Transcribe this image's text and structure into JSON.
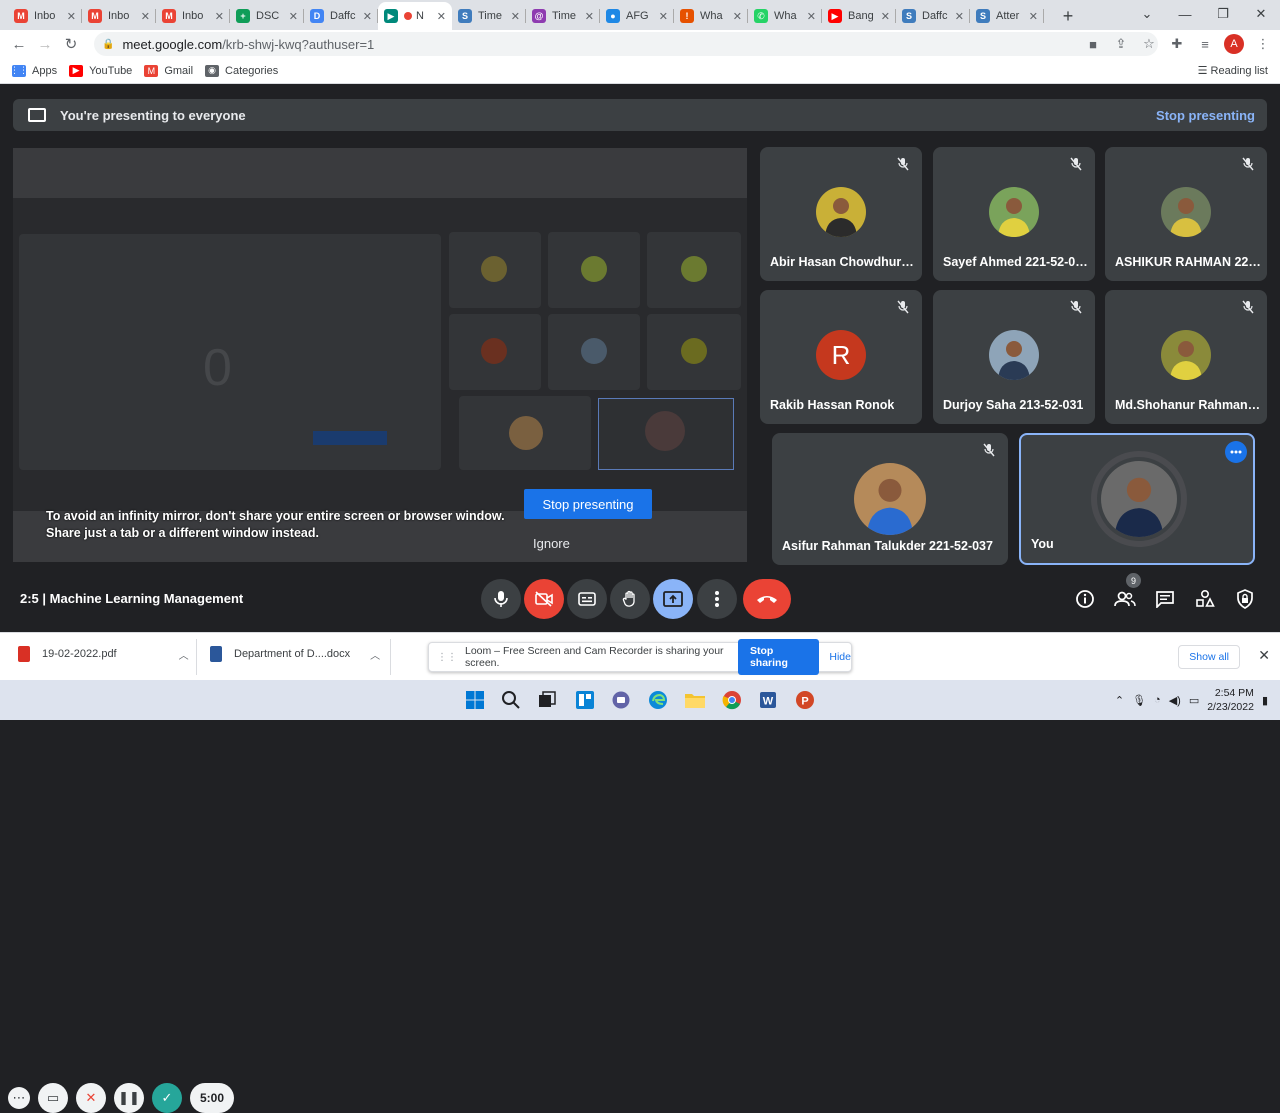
{
  "browser": {
    "tabs": [
      {
        "label": "Inbo",
        "color": "#ea4335",
        "glyph": "M"
      },
      {
        "label": "Inbo",
        "color": "#ea4335",
        "glyph": "M"
      },
      {
        "label": "Inbo",
        "color": "#ea4335",
        "glyph": "M"
      },
      {
        "label": "DSC",
        "color": "#0f9d58",
        "glyph": "+"
      },
      {
        "label": "Daffc",
        "color": "#4285f4",
        "glyph": "D"
      },
      {
        "label": "N",
        "color": "#00897b",
        "glyph": "▶",
        "active": true
      },
      {
        "label": "Time",
        "color": "#3f7cbd",
        "glyph": "S"
      },
      {
        "label": "Time",
        "color": "#8e3bb0",
        "glyph": "@"
      },
      {
        "label": "AFG",
        "color": "#1e88e5",
        "glyph": "●"
      },
      {
        "label": "Wha",
        "color": "#e65100",
        "glyph": "!"
      },
      {
        "label": "Wha",
        "color": "#25d366",
        "glyph": "✆"
      },
      {
        "label": "Bang",
        "color": "#ff0000",
        "glyph": "▶"
      },
      {
        "label": "Daffc",
        "color": "#3f7cbd",
        "glyph": "S"
      },
      {
        "label": "Atter",
        "color": "#3f7cbd",
        "glyph": "S"
      }
    ],
    "url_host": "meet.google.com",
    "url_path": "/krb-shwj-kwq?authuser=1",
    "profile_initial": "A",
    "bookmarks": [
      {
        "label": "Apps",
        "color": "#4285f4",
        "glyph": "⋮⋮"
      },
      {
        "label": "YouTube",
        "color": "#ff0000",
        "glyph": "▶"
      },
      {
        "label": "Gmail",
        "color": "#ea4335",
        "glyph": "M"
      },
      {
        "label": "Categories",
        "color": "#5f6368",
        "glyph": "◉"
      }
    ],
    "reading_list": "Reading list"
  },
  "meet": {
    "banner_text": "You're presenting to everyone",
    "banner_stop": "Stop presenting",
    "infinity_msg_1": "To avoid an infinity mirror, don't share your entire screen or browser window.",
    "infinity_msg_2": "Share just a tab or a different window instead.",
    "stop_presenting_button": "Stop presenting",
    "ignore_button": "Ignore",
    "participants": [
      {
        "name": "Abir Hasan Chowdhury ...",
        "type": "photo",
        "bg": "#c9b037",
        "fg": "#2b2b2b"
      },
      {
        "name": "Sayef Ahmed 221-52-034",
        "type": "photo",
        "bg": "#7aa35b",
        "fg": "#e0d040"
      },
      {
        "name": "ASHIKUR RAHMAN 221-...",
        "type": "photo",
        "bg": "#6b7a5c",
        "fg": "#d8c040"
      },
      {
        "name": "Rakib Hassan Ronok",
        "type": "letter",
        "letter": "R"
      },
      {
        "name": "Durjoy Saha 213-52-031",
        "type": "photo",
        "bg": "#8ea4b8",
        "fg": "#2a3b55"
      },
      {
        "name": "Md.Shohanur Rahman 2...",
        "type": "photo",
        "bg": "#8a8a3a",
        "fg": "#e0d040"
      },
      {
        "name": "Asifur Rahman Talukder 221-52-037",
        "type": "photo",
        "bg": "#b58a5a",
        "fg": "#2a6bd0"
      },
      {
        "name": "You",
        "type": "self",
        "bg": "#6a6a6a",
        "fg": "#1a2a4a"
      }
    ],
    "meeting_info": "2:5 | Machine Learning Management",
    "participant_count": "9"
  },
  "loom": {
    "timer": "5:00"
  },
  "downloads": {
    "item1": "19-02-2022.pdf",
    "item2": "Department of D....docx",
    "loom_msg": "Loom – Free Screen and Cam Recorder is sharing your screen.",
    "stop_sharing": "Stop sharing",
    "hide": "Hide",
    "show_all": "Show all"
  },
  "taskbar": {
    "time": "2:54 PM",
    "date": "2/23/2022"
  }
}
